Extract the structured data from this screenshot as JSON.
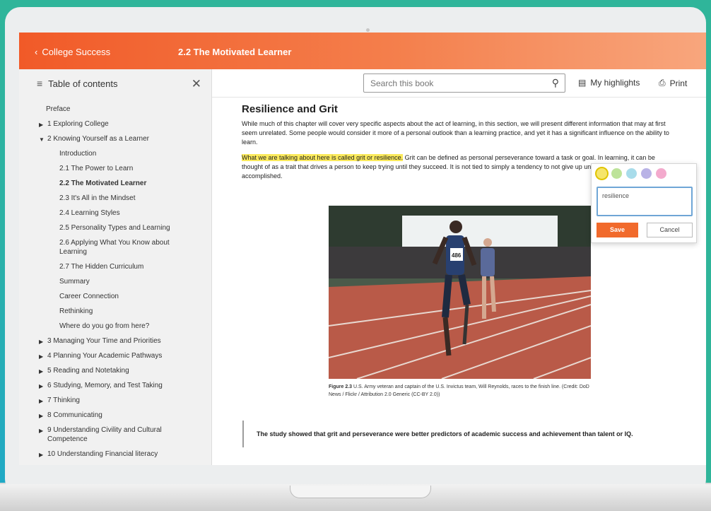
{
  "header": {
    "back_label": "College Success",
    "book_title": "2.2 The Motivated Learner"
  },
  "sidebar": {
    "title": "Table of contents",
    "items": [
      {
        "label": "Preface",
        "indent": 0,
        "caret": "",
        "active": false
      },
      {
        "label": "1   Exploring College",
        "indent": 1,
        "caret": "right",
        "active": false
      },
      {
        "label": "2   Knowing Yourself as a Learner",
        "indent": 1,
        "caret": "down",
        "active": false
      },
      {
        "label": "Introduction",
        "indent": 2,
        "caret": "",
        "active": false
      },
      {
        "label": "2.1  The Power to Learn",
        "indent": 2,
        "caret": "",
        "active": false
      },
      {
        "label": "2.2  The Motivated Learner",
        "indent": 2,
        "caret": "",
        "active": true
      },
      {
        "label": "2.3  It's All in the Mindset",
        "indent": 2,
        "caret": "",
        "active": false
      },
      {
        "label": "2.4  Learning Styles",
        "indent": 2,
        "caret": "",
        "active": false
      },
      {
        "label": "2.5  Personality Types and Learning",
        "indent": 2,
        "caret": "",
        "active": false
      },
      {
        "label": "2.6  Applying What You Know about Learning",
        "indent": 2,
        "caret": "",
        "active": false
      },
      {
        "label": "2.7  The Hidden Curriculum",
        "indent": 2,
        "caret": "",
        "active": false
      },
      {
        "label": "Summary",
        "indent": 2,
        "caret": "",
        "active": false
      },
      {
        "label": "Career Connection",
        "indent": 2,
        "caret": "",
        "active": false
      },
      {
        "label": "Rethinking",
        "indent": 2,
        "caret": "",
        "active": false
      },
      {
        "label": "Where do you go from here?",
        "indent": 2,
        "caret": "",
        "active": false
      },
      {
        "label": "3   Managing Your Time and Priorities",
        "indent": 1,
        "caret": "right",
        "active": false
      },
      {
        "label": "4   Planning Your Academic Pathways",
        "indent": 1,
        "caret": "right",
        "active": false
      },
      {
        "label": "5   Reading and Notetaking",
        "indent": 1,
        "caret": "right",
        "active": false
      },
      {
        "label": "6   Studying, Memory, and Test Taking",
        "indent": 1,
        "caret": "right",
        "active": false
      },
      {
        "label": "7   Thinking",
        "indent": 1,
        "caret": "right",
        "active": false
      },
      {
        "label": "8   Communicating",
        "indent": 1,
        "caret": "right",
        "active": false
      },
      {
        "label": "9   Understanding Civility and Cultural Competence",
        "indent": 1,
        "caret": "right",
        "active": false
      },
      {
        "label": "10  Understanding Financial literacy",
        "indent": 1,
        "caret": "right",
        "active": false
      }
    ]
  },
  "toolbar": {
    "search_placeholder": "Search this book",
    "highlights_label": "My highlights",
    "print_label": "Print"
  },
  "content": {
    "heading": "Resilience and Grit",
    "para1": "While much of this chapter will cover very specific aspects about the act of learning, in this section, we will present different information that may at first seem unrelated. Some people would consider it more of a personal outlook than a learning practice, and yet it has a significant influence on the ability to learn.",
    "para2_highlight": "What we are talking about here is called grit or resilience.",
    "para2_rest": " Grit can be defined as personal perseverance toward a task or goal. In learning, it can be thought of as a trait that drives a person to keep trying until they succeed. It is not tied to simply a tendency to not give up until something is finished or accomplished.",
    "caption_label": "Figure 2.3",
    "caption_text": " U.S. Army veteran and captain of the U.S. Invictus team, Will Reynolds, races to the finish line. (Credit: DoD News / Flickr / Attribution 2.0 Generic (CC-BY 2.0))",
    "bib_number": "486",
    "quote": "The study showed that grit and perseverance were better predictors of academic success and achievement than talent or IQ."
  },
  "highlight_popup": {
    "colors": [
      "#f5e56b",
      "#bde39a",
      "#a8dcea",
      "#b9b3e6",
      "#f3aacd"
    ],
    "note_value": "resilience",
    "save_label": "Save",
    "cancel_label": "Cancel"
  }
}
